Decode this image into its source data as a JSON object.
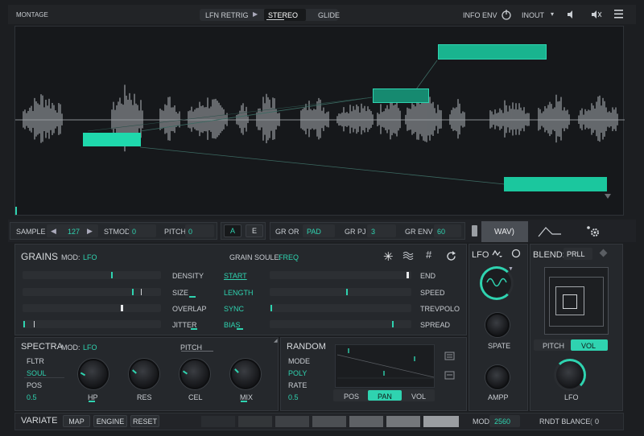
{
  "topbar": {
    "title": "MONTAGE",
    "tabs": [
      "LFN RETRIG",
      "STEREO",
      "GLIDE"
    ],
    "info_env": "INFO ENV",
    "inout": "INOUT"
  },
  "waveform": {
    "blocks": [
      "block-1",
      "block-2",
      "block-3",
      "block-4"
    ]
  },
  "params": {
    "sample_label": "SAMPLE",
    "sample_value": "127",
    "stmod_label": "STMOD",
    "stmod_value": "0",
    "pitch_label": "PITCH",
    "pitch_value": "0",
    "ab_a": "A",
    "ab_e": "E",
    "gror_label": "GR OR",
    "gror_value": "PAD",
    "grpj_label": "GR PJ",
    "grpj_value": "3",
    "grenv_label": "GR ENV",
    "grenv_value": "60",
    "wav_tab": "WAV)"
  },
  "grains": {
    "title": "GRAINS",
    "mod_label": "MOD:",
    "mod_value": "LFO",
    "source_label": "GRAIN SOULE:",
    "source_value": "FREQ",
    "rows": [
      {
        "left": "DENSITY",
        "right": "START",
        "end": "END"
      },
      {
        "left": "SIZE",
        "right": "LENGTH",
        "end": "SPEED"
      },
      {
        "left": "OVERLAP",
        "right": "SYNC",
        "end": "TREVPOLO"
      },
      {
        "left": "JITTER",
        "right": "BIAS",
        "end": "SPREAD"
      }
    ]
  },
  "lfo": {
    "title": "LFO",
    "spate": "SPATE",
    "ampp": "AMPP"
  },
  "blend": {
    "title": "BLEND:",
    "value": "PRLL",
    "pitch_tab": "PITCH",
    "vol_tab": "VOL",
    "lfo_label": "LFO"
  },
  "spectra": {
    "title": "SPECTRA",
    "mod_label": "MOD:",
    "mod_value": "LFO",
    "fltr_label": "FLTR",
    "fltr_value": "SOUL",
    "pos_label": "POS",
    "pos_value": "0.5",
    "pitch_label": "PITCH",
    "knobs": [
      "HP",
      "RES",
      "CEL",
      "MIX"
    ]
  },
  "random": {
    "title": "RANDOM",
    "mode_label": "MODE",
    "mode_value": "POLY",
    "rate_label": "RATE",
    "rate_value": "0.5",
    "tabs": [
      "POS",
      "PAN",
      "VOL"
    ]
  },
  "bottombar": {
    "variate": "VARIATE",
    "buttons": [
      "MAP",
      "ENGINE",
      "RESET"
    ],
    "mod_label": "MOD",
    "mod_value": "2560",
    "rndt": "RNDT BLANCE",
    "rndt_value": "0"
  },
  "colors": {
    "accent": "#2fd3b0",
    "background": "#1c1e21"
  }
}
